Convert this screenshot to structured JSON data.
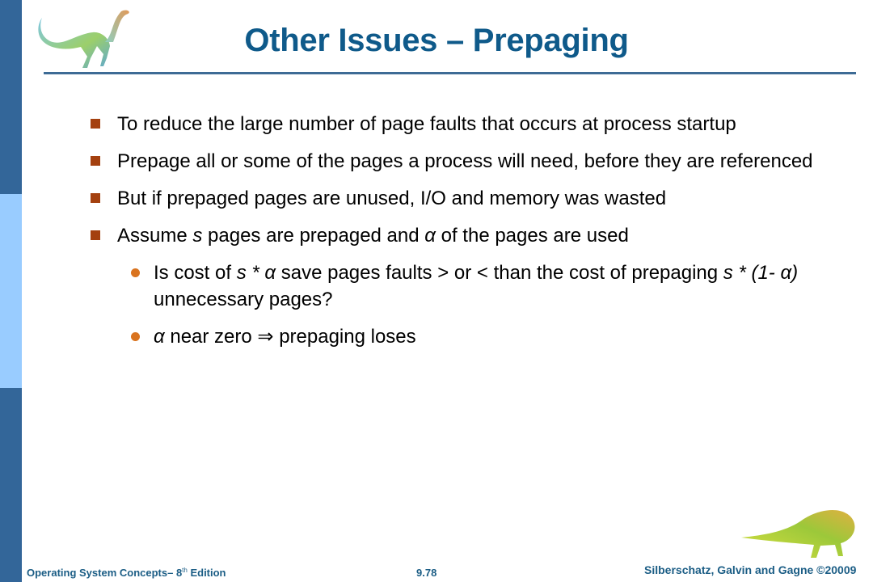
{
  "slide": {
    "title": "Other Issues – Prepaging",
    "colors": {
      "sidebar_dark": "#336699",
      "sidebar_light": "#99ccff",
      "title": "#0f5a8a",
      "bullet_level1": "#a4400f",
      "bullet_level2": "#d9731f",
      "footer_text": "#1b5d85"
    },
    "bullets": [
      {
        "text": "To reduce the large number of page faults that occurs at process startup"
      },
      {
        "text": "Prepage all or some of the pages a process will need, before they are referenced"
      },
      {
        "text": "But if prepaged pages are unused, I/O and memory was wasted"
      },
      {
        "parts": [
          "Assume ",
          "s",
          " pages are prepaged and ",
          "α",
          " of the pages are used"
        ]
      }
    ],
    "sub_bullets": [
      {
        "parts": [
          "Is cost of ",
          "s * α",
          "  save pages faults > or < than the cost of prepaging ",
          "s * (1- α)",
          " unnecessary pages?"
        ]
      },
      {
        "parts": [
          "α",
          " near zero ⇒ prepaging loses"
        ]
      }
    ],
    "icons": {
      "top_logo": "dinosaur-logo-icon",
      "bottom_logo": "dinosaur-logo-icon"
    }
  },
  "footer": {
    "book_title": "Operating System Concepts– 8",
    "edition_sup": "th",
    "edition_word": " Edition",
    "page_number": "9.78",
    "copyright": "Silberschatz, Galvin and Gagne ©20009"
  }
}
